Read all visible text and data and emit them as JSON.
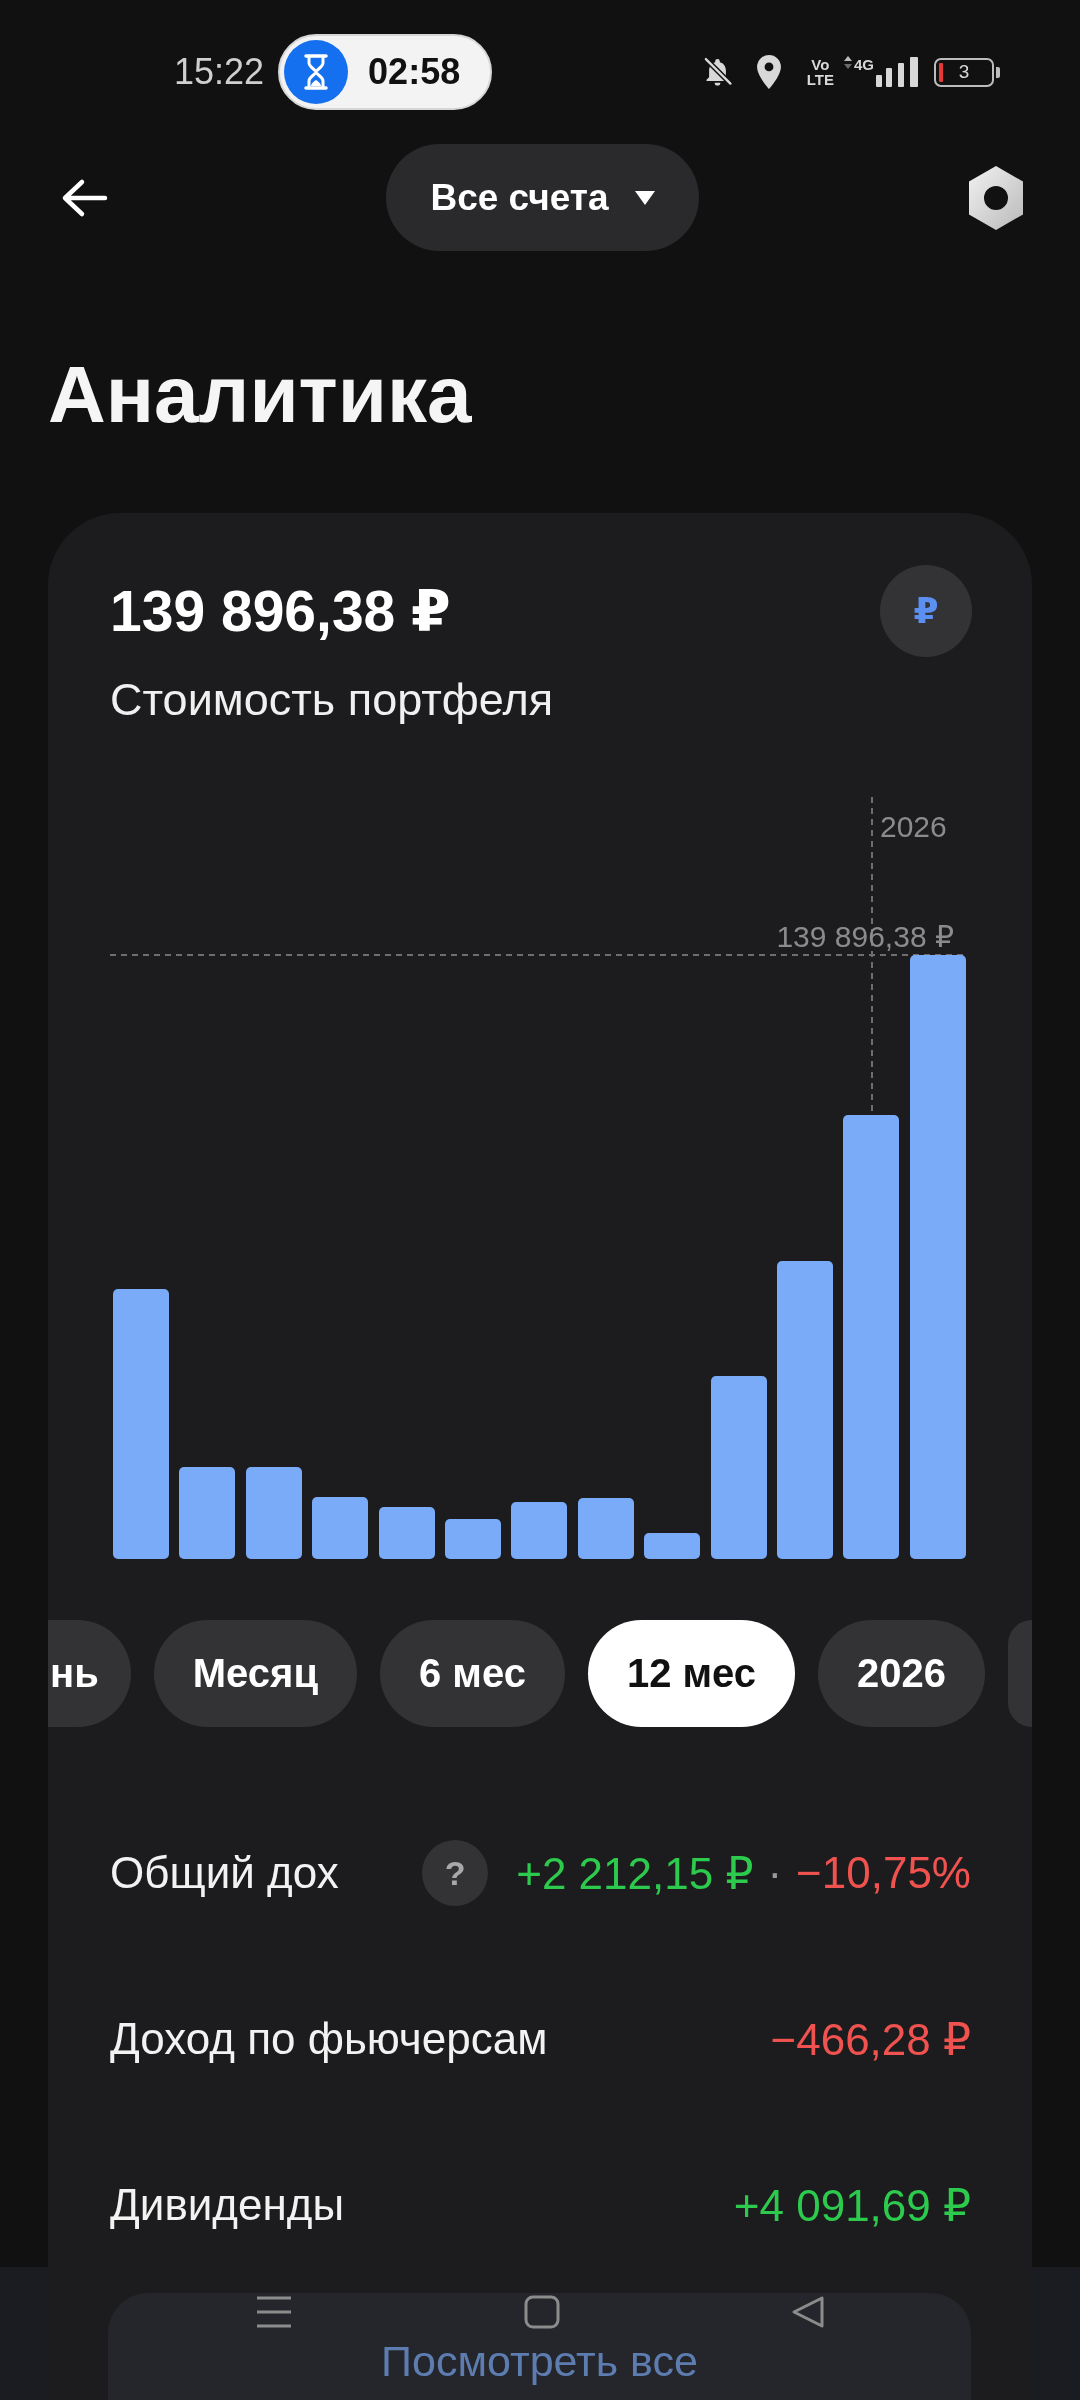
{
  "status_bar": {
    "time": "15:22",
    "timer": "02:58",
    "volte": [
      "Vo",
      "LTE"
    ],
    "network": "4G",
    "battery": "3"
  },
  "header": {
    "account_selector": "Все счета"
  },
  "title": "Аналитика",
  "portfolio": {
    "value": "139 896,38 ₽",
    "currency": "₽",
    "caption": "Стоимость портфеля"
  },
  "chart": {
    "cursor_label": "2026",
    "value_label": "139 896,38 ₽"
  },
  "periods": [
    {
      "label": "нь",
      "selected": false
    },
    {
      "label": "Месяц",
      "selected": false
    },
    {
      "label": "6 мес",
      "selected": false
    },
    {
      "label": "12 мес",
      "selected": true
    },
    {
      "label": "2026",
      "selected": false
    }
  ],
  "stats": [
    {
      "label": "Общий дох",
      "help": "?",
      "value": {
        "text": "+2 212,15 ₽",
        "color": "#2ccb4d"
      },
      "separator": "·",
      "change": {
        "text": "−10,75%",
        "color": "#f0534f"
      }
    },
    {
      "label": "Доход по фьючерсам",
      "value": {
        "text": "−466,28 ₽",
        "color": "#f0534f"
      }
    },
    {
      "label": "Дивиденды",
      "value": {
        "text": "+4 091,69 ₽",
        "color": "#2ccb4d"
      }
    }
  ],
  "view_all": "Посмотреть все"
}
